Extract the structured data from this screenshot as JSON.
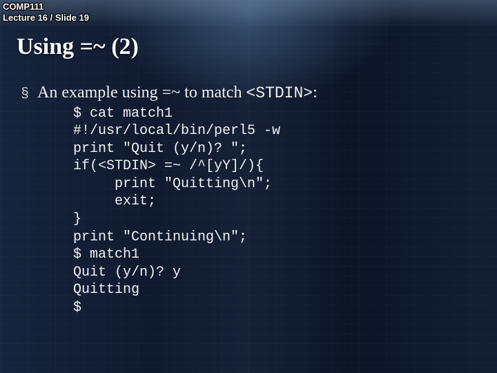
{
  "header": {
    "course": "COMP111",
    "lecture_slide": "Lecture 16 / Slide 19"
  },
  "title": "Using =~ (2)",
  "bullet": {
    "glyph": "§",
    "text_prefix": "An example using =~ to match ",
    "mono": "<STDIN>",
    "text_suffix": ":"
  },
  "code_lines": [
    "$ cat match1",
    "#!/usr/local/bin/perl5 -w",
    "print \"Quit (y/n)? \";",
    "if(<STDIN> =~ /^[yY]/){",
    "     print \"Quitting\\n\";",
    "     exit;",
    "}",
    "print \"Continuing\\n\";",
    "$ match1",
    "Quit (y/n)? y",
    "Quitting",
    "$"
  ]
}
